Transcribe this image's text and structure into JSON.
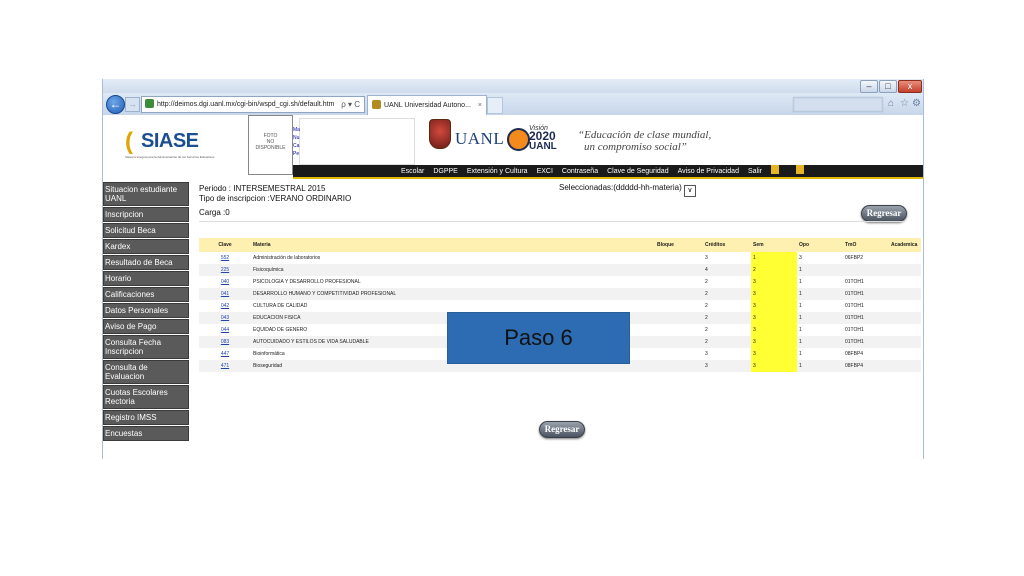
{
  "browser": {
    "url": "http://deimos.dgi.uanl.mx/cgi-bin/wspd_cgi.sh/default.htm",
    "url_controls": "ρ ▾ C",
    "tab_title": "UANL Universidad Autono...",
    "tab_close": "×",
    "window_controls": {
      "minimize": "–",
      "maximize": "□",
      "close": "x"
    },
    "toolbar_icons": [
      "home-icon",
      "star-icon",
      "gear-icon"
    ]
  },
  "header": {
    "logo_text": "SIASE",
    "logo_tagline": "Sistema Integral para la Administración de los Servicios Educativos",
    "photo_text": [
      "FOTO",
      "NO",
      "DISPONIBLE"
    ],
    "info_letters": [
      "Ma",
      "Nu",
      "Ca",
      "Pe"
    ],
    "uanl_text": "UANL",
    "vision_top": "Visión",
    "vision_year": "2020",
    "vision_bottom": "UANL",
    "motto_line1": "“Educación de clase mundial,",
    "motto_line2": "un compromiso social”"
  },
  "topmenu": [
    "Escolar",
    "DGPPE",
    "Extensión y Cultura",
    "EXCI",
    "Contraseña",
    "Clave de Seguridad",
    "Aviso de Privacidad",
    "Salir"
  ],
  "sidemenu": [
    "Situacion estudiante UANL",
    "Inscripcion",
    "Solicitud Beca",
    "Kardex",
    "Resultado de Beca",
    "Horario",
    "Calificaciones",
    "Datos Personales",
    "Aviso de Pago",
    "Consulta Fecha Inscripcion",
    "Consulta de Evaluacion",
    "Cuotas Escolares Rectoria",
    "Registro IMSS",
    "Encuestas"
  ],
  "info": {
    "periodo": "Periodo :  INTERSEMESTRAL 2015",
    "tipo": "Tipo de inscripcion :VERANO ORDINARIO",
    "carga": "Carga :0",
    "seleccionadas": "Seleccionadas:(ddddd-hh-materia)",
    "select_arrow": "∨"
  },
  "buttons": {
    "regresar": "Regresar"
  },
  "table": {
    "headers": [
      "Clave",
      "Materia",
      "Bloque",
      "Créditos",
      "Sem",
      "Opo",
      "TmO",
      "Academica"
    ],
    "rows": [
      [
        "552",
        "Administración de laboratorios",
        "",
        "3",
        "1",
        "3",
        "06FBP2"
      ],
      [
        "225",
        "Fisicoquímica",
        "",
        "4",
        "2",
        "1",
        ""
      ],
      [
        "040",
        "PSICOLOGIA Y DESARROLLO PROFESIONAL",
        "",
        "2",
        "3",
        "1",
        "01TOH1"
      ],
      [
        "041",
        "DESARROLLO HUMANO Y COMPETITIVIDAD PROFESIONAL",
        "",
        "2",
        "3",
        "1",
        "01TOH1"
      ],
      [
        "042",
        "CULTURA DE CALIDAD",
        "",
        "2",
        "3",
        "1",
        "01TOH1"
      ],
      [
        "043",
        "EDUCACION FISICA",
        "",
        "2",
        "3",
        "1",
        "01TOH1"
      ],
      [
        "044",
        "EQUIDAD DE GENERO",
        "",
        "2",
        "3",
        "1",
        "01TOH1"
      ],
      [
        "083",
        "AUTOCUIDADO Y ESTILOS DE VIDA SALUDABLE",
        "",
        "2",
        "3",
        "1",
        "01TOH1"
      ],
      [
        "447",
        "Bioinformática",
        "",
        "3",
        "3",
        "1",
        "08FBP4"
      ],
      [
        "471",
        "Bioseguridad",
        "",
        "3",
        "3",
        "1",
        "08FBP4"
      ]
    ]
  },
  "overlay": {
    "label": "Paso 6"
  },
  "colors": {
    "sem_highlight": "#ffff33",
    "header_row": "#fdf0b0",
    "side_menu": "#5a5a5a",
    "overlay": "#2d6cb2"
  }
}
